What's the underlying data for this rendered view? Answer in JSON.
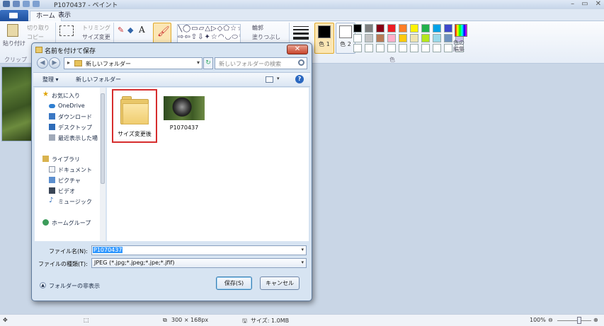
{
  "paint": {
    "title": "P1070437 - ペイント",
    "tabs": [
      "ホーム",
      "表示"
    ],
    "ribbon": {
      "paste": "貼り付け",
      "cut": "切り取り",
      "copy": "コピー",
      "clipboard_group": "クリップ",
      "trim": "トリミング",
      "resize": "サイズ変更",
      "outline": "輪郭",
      "fill": "塗りつぶし",
      "color1": "色 1",
      "color2": "色 2",
      "edit_colors": "色の編集",
      "colors_group": "色"
    },
    "palette": [
      "#000000",
      "#7f7f7f",
      "#880015",
      "#ed1c24",
      "#ff7f27",
      "#fff200",
      "#22b14c",
      "#00a2e8",
      "#3f48cc",
      "#a349a4",
      "#ffffff",
      "#c3c3c3",
      "#b97a57",
      "#ffaec9",
      "#ffc90e",
      "#efe4b0",
      "#b5e61d",
      "#99d9ea",
      "#7092be",
      "#c8bfe7",
      "#ffffff",
      "#ffffff",
      "#ffffff",
      "#ffffff",
      "#ffffff",
      "#ffffff",
      "#ffffff",
      "#ffffff",
      "#ffffff",
      "#ffffff"
    ],
    "status": {
      "dimensions": "300 × 168px",
      "size": "サイズ: 1.0MB",
      "zoom": "100%"
    }
  },
  "dialog": {
    "title": "名前を付けて保存",
    "address": "新しいフォルダー",
    "search_placeholder": "新しいフォルダーの検索",
    "organize": "整理 ▾",
    "new_folder": "新しいフォルダー",
    "nav": {
      "favorites": "お気に入り",
      "onedrive": "OneDrive",
      "downloads": "ダウンロード",
      "desktop": "デスクトップ",
      "recent": "最近表示した場",
      "libraries": "ライブラリ",
      "documents": "ドキュメント",
      "pictures": "ピクチャ",
      "videos": "ビデオ",
      "music": "ミュージック",
      "homegroup": "ホームグループ"
    },
    "files": {
      "folder": "サイズ変更後",
      "photo": "P1070437"
    },
    "filename_label": "ファイル名(N):",
    "filename_value": "P1070437",
    "filetype_label": "ファイルの種類(T):",
    "filetype_value": "JPEG (*.jpg;*.jpeg;*.jpe;*.jfif)",
    "hide_folders": "フォルダーの非表示",
    "save": "保存(S)",
    "cancel": "キャンセル"
  }
}
